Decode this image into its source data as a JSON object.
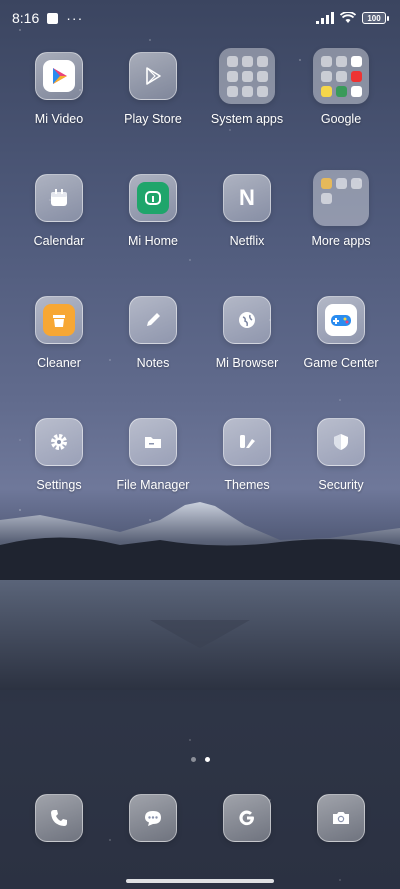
{
  "status_bar": {
    "time": "8:16",
    "battery": "100",
    "icons": [
      "notification-square-icon",
      "more-dots-icon",
      "signal-icon",
      "wifi-icon",
      "battery-icon"
    ]
  },
  "apps": [
    {
      "label": "Mi Video",
      "icon": "mi-video-icon"
    },
    {
      "label": "Play Store",
      "icon": "play-store-icon"
    },
    {
      "label": "System apps",
      "icon": "folder-icon"
    },
    {
      "label": "Google",
      "icon": "folder-icon"
    },
    {
      "label": "Calendar",
      "icon": "calendar-icon"
    },
    {
      "label": "Mi Home",
      "icon": "mi-home-icon"
    },
    {
      "label": "Netflix",
      "icon": "netflix-icon",
      "letter": "N"
    },
    {
      "label": "More apps",
      "icon": "folder-icon"
    },
    {
      "label": "Cleaner",
      "icon": "cleaner-icon"
    },
    {
      "label": "Notes",
      "icon": "pencil-icon"
    },
    {
      "label": "Mi Browser",
      "icon": "globe-icon"
    },
    {
      "label": "Game Center",
      "icon": "gamepad-icon"
    },
    {
      "label": "Settings",
      "icon": "gear-icon"
    },
    {
      "label": "File Manager",
      "icon": "folder-file-icon"
    },
    {
      "label": "Themes",
      "icon": "themes-icon"
    },
    {
      "label": "Security",
      "icon": "shield-icon"
    }
  ],
  "pager": {
    "pages": 2,
    "active": 2
  },
  "dock": [
    {
      "icon": "phone-icon"
    },
    {
      "icon": "messages-icon"
    },
    {
      "icon": "google-icon"
    },
    {
      "icon": "camera-icon"
    }
  ],
  "colors": {
    "cleaner": "#f7a734",
    "mi_home": "#1fa56b",
    "game_center": "#2a8cf0",
    "play_store": "#5c6b86"
  }
}
